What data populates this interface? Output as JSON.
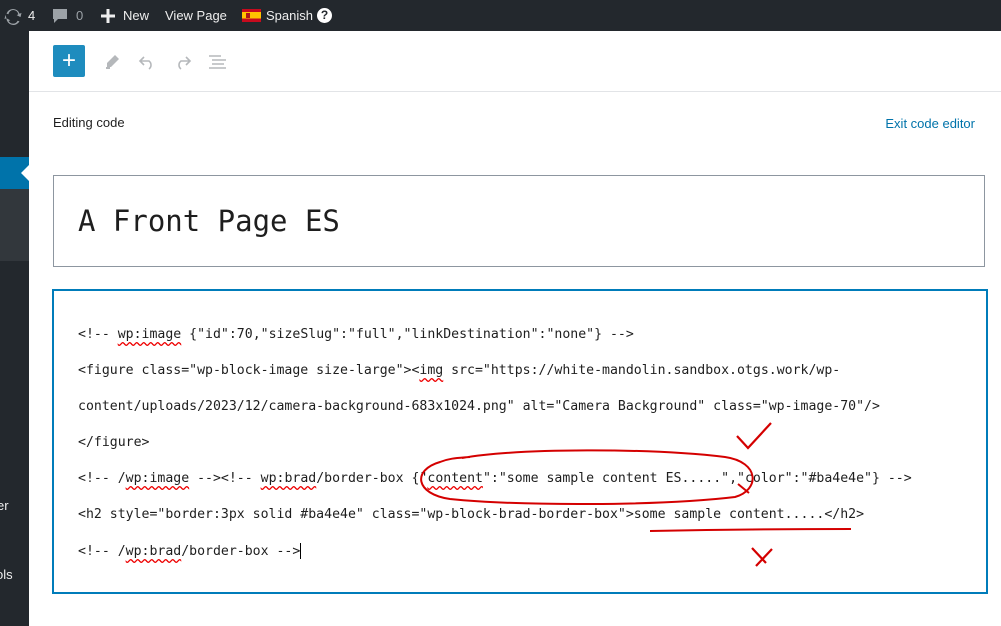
{
  "admin_bar": {
    "updates_count": "4",
    "comments_count": "0",
    "new_label": "New",
    "view_page_label": "View Page",
    "language_label": "Spanish",
    "help_glyph": "?"
  },
  "sidebar": {
    "cut_labels": [
      "er",
      "ols"
    ]
  },
  "toolbar": {
    "add_icon": "+",
    "icons": [
      "add-block-icon",
      "edit-pencil-icon",
      "undo-icon",
      "redo-icon",
      "outline-list-icon"
    ]
  },
  "editor": {
    "editing_label": "Editing code",
    "exit_label": "Exit code editor",
    "title": "A Front Page ES",
    "code_lines": [
      {
        "segments": [
          {
            "t": "<!-- "
          },
          {
            "t": "wp:image",
            "sq": true
          },
          {
            "t": " {\"id\":70,\"sizeSlug\":\"full\",\"linkDestination\":\"none\"} -->"
          }
        ]
      },
      {
        "segments": [
          {
            "t": "<figure class=\"wp-block-image size-large\"><"
          },
          {
            "t": "img",
            "sq": true
          },
          {
            "t": " src=\"https://white-mandolin.sandbox.otgs.work/wp-"
          }
        ]
      },
      {
        "segments": [
          {
            "t": "content/uploads/2023/12/camera-background-683x1024.png\" alt=\"Camera Background\" class=\"wp-image-70\"/>"
          }
        ]
      },
      {
        "segments": [
          {
            "t": "</figure>"
          }
        ]
      },
      {
        "segments": [
          {
            "t": "<!-- /"
          },
          {
            "t": "wp:image",
            "sq": true
          },
          {
            "t": " --><!-- "
          },
          {
            "t": "wp:brad",
            "sq": true
          },
          {
            "t": "/border-box {\""
          },
          {
            "t": "content",
            "sq": true
          },
          {
            "t": "\":\"some sample content ES.....\",\"color\":\"#ba4e4e\"} -->"
          }
        ]
      },
      {
        "segments": [
          {
            "t": "<h2 style=\"border:3px solid #ba4e4e\" class=\"wp-block-brad-border-box\">some sample content.....</h2>"
          }
        ]
      },
      {
        "segments": [
          {
            "t": "<!-- /"
          },
          {
            "t": "wp:brad",
            "sq": true
          },
          {
            "t": "/border-box -->"
          }
        ],
        "caret": true
      }
    ]
  },
  "colors": {
    "admin_bar_bg": "#23282d",
    "accent_blue": "#0073aa",
    "annotation_red": "#d40000"
  }
}
